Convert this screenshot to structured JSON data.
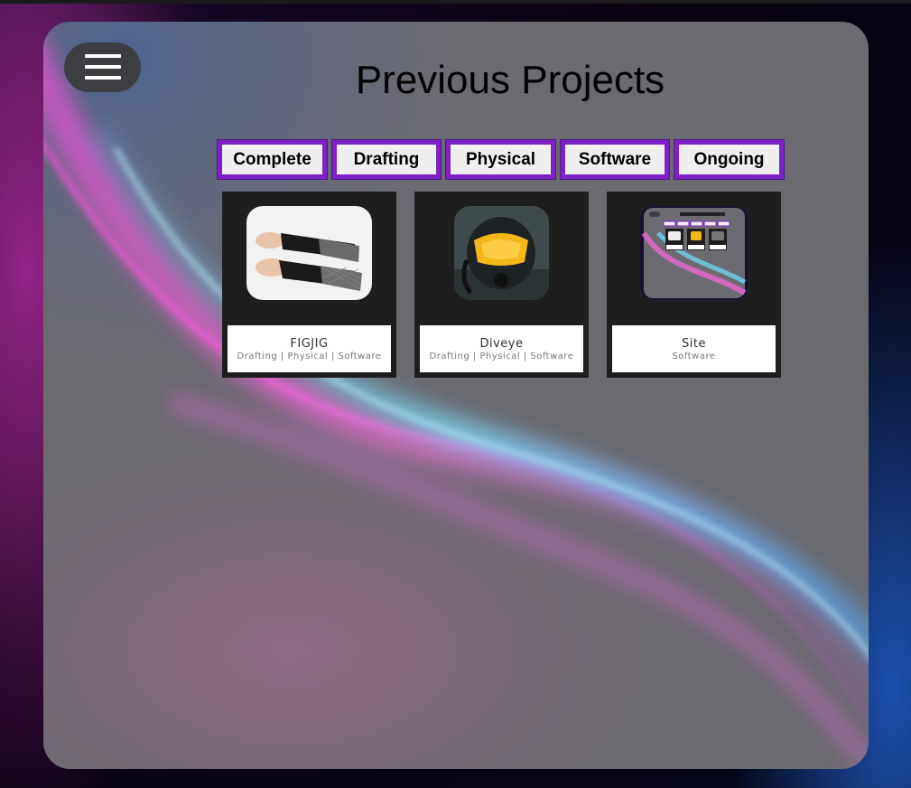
{
  "header": {
    "title": "Previous Projects",
    "menu_icon": "hamburger-menu-icon"
  },
  "filters": [
    {
      "label": "Complete"
    },
    {
      "label": "Drafting"
    },
    {
      "label": "Physical"
    },
    {
      "label": "Software"
    },
    {
      "label": "Ongoing"
    }
  ],
  "projects": [
    {
      "name": "FIGJIG",
      "tags": "Drafting | Physical | Software",
      "image": "wrist-brace-photo"
    },
    {
      "name": "Diveye",
      "tags": "Drafting | Physical | Software",
      "image": "diving-helmet-photo"
    },
    {
      "name": "Site",
      "tags": "Software",
      "image": "site-screenshot-thumbnail"
    }
  ],
  "colors": {
    "filter_border": "#7e22c7",
    "card_background": "#1e1e1e",
    "panel_background": "#6b6a70",
    "menu_button": "#3e3f43"
  }
}
